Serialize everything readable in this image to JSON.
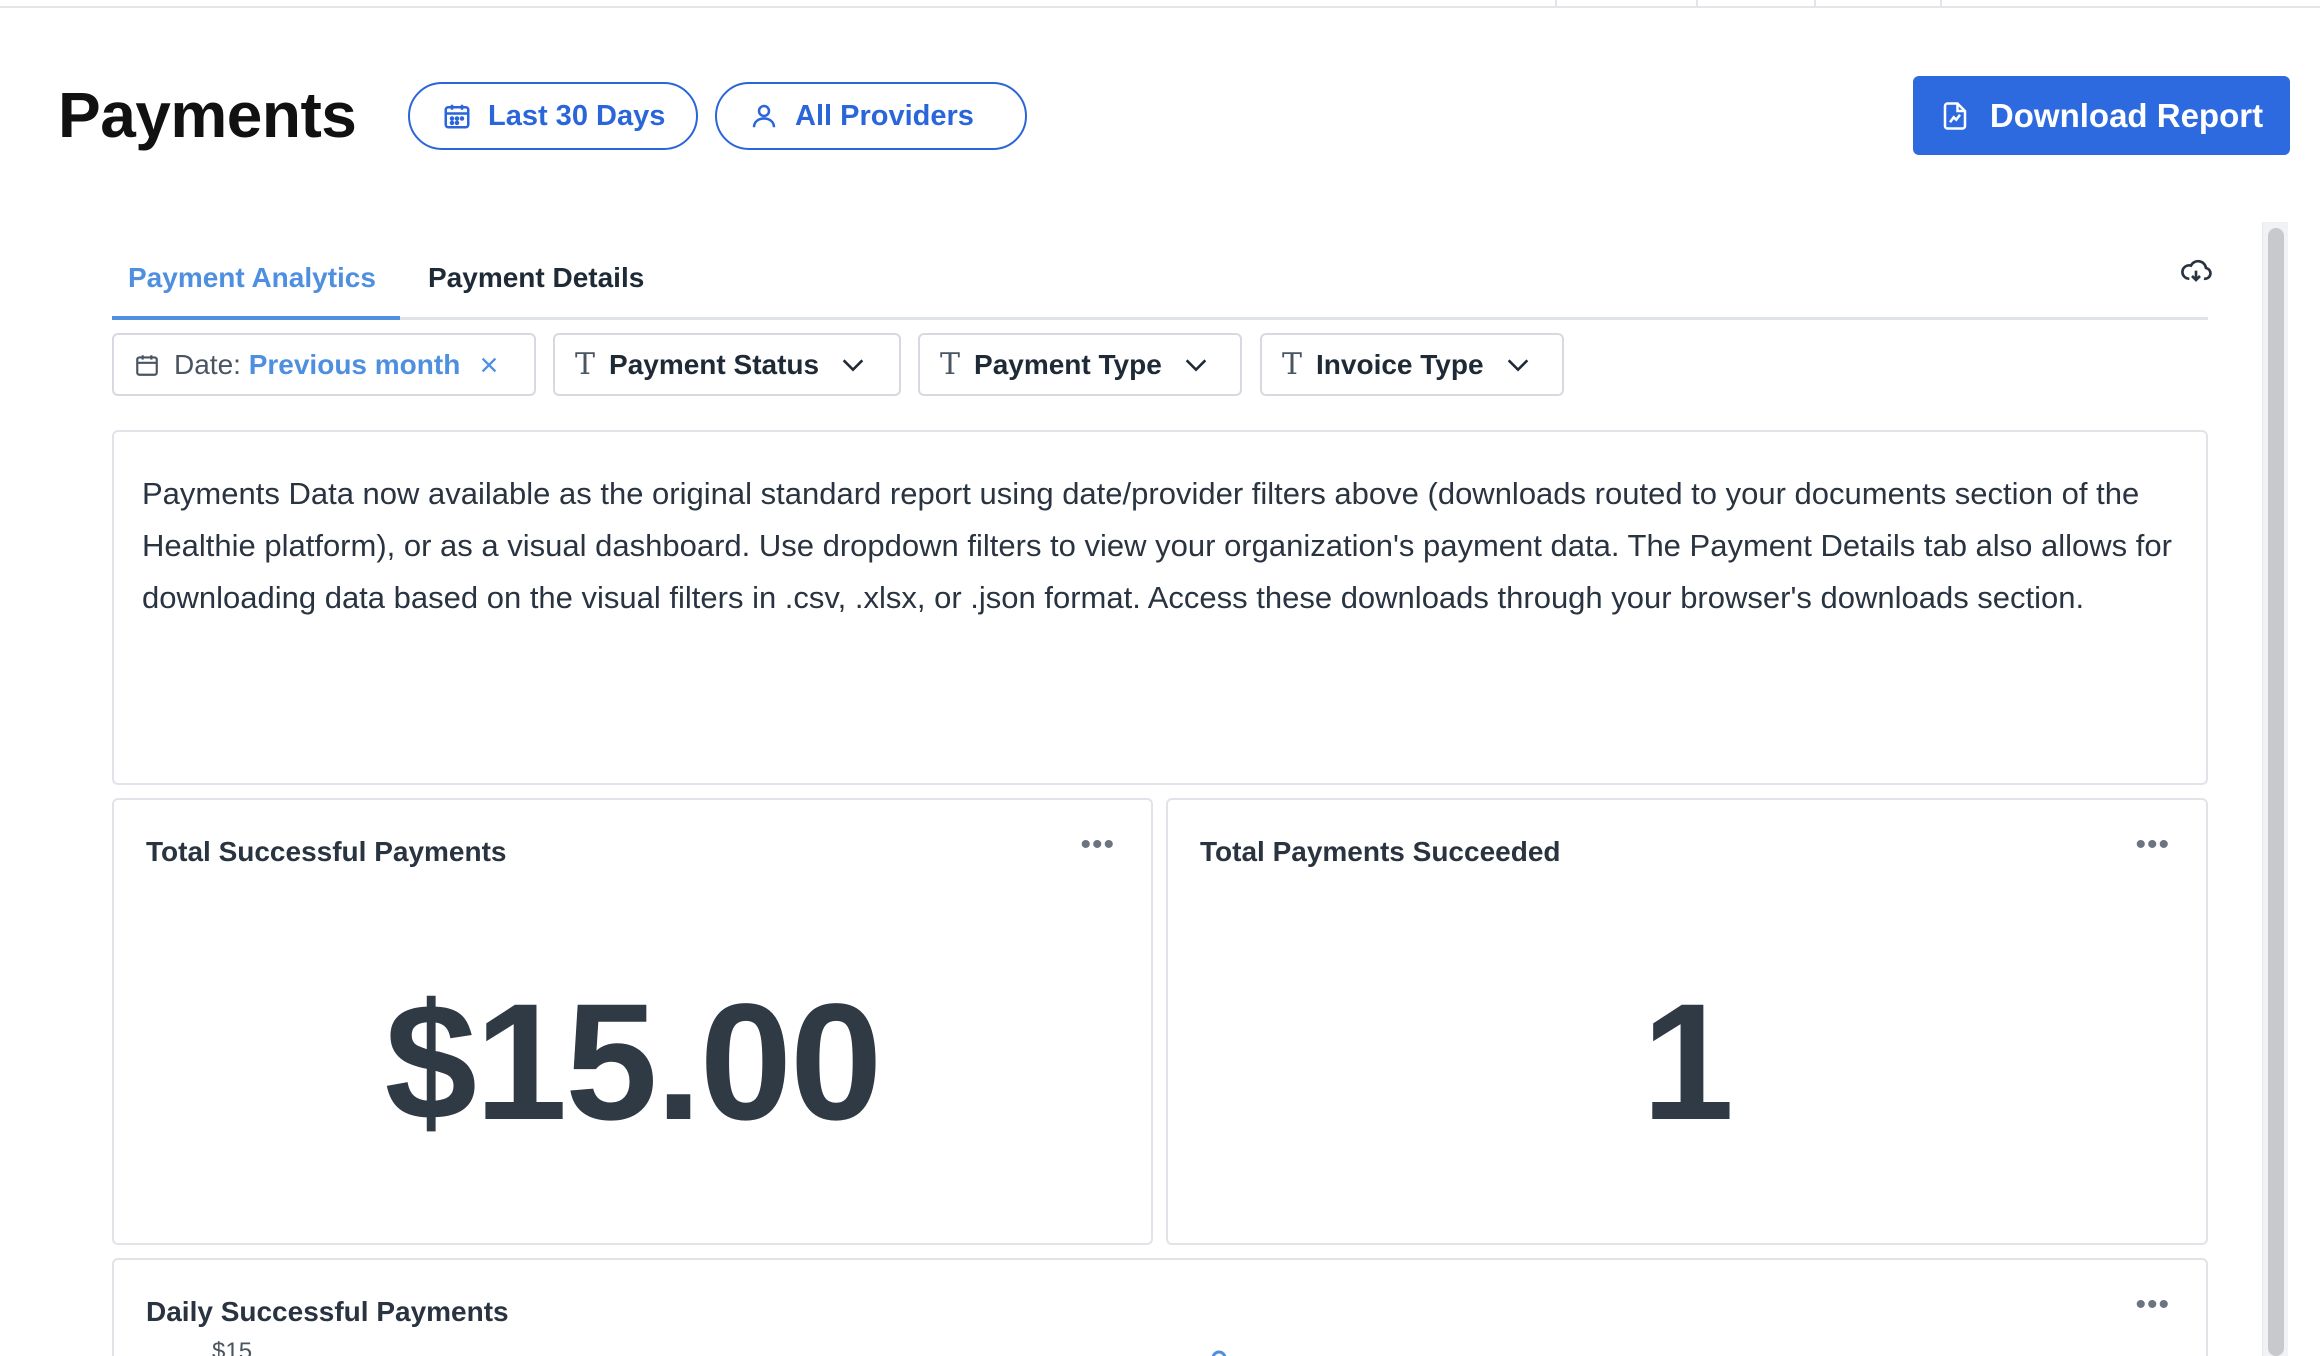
{
  "header": {
    "title": "Payments",
    "date_pill": "Last 30 Days",
    "provider_pill": "All Providers",
    "download_button": "Download Report"
  },
  "tabs": [
    {
      "label": "Payment Analytics",
      "active": true
    },
    {
      "label": "Payment Details",
      "active": false
    }
  ],
  "filters": {
    "date_label": "Date:",
    "date_value": "Previous month",
    "payment_status": "Payment Status",
    "payment_type": "Payment Type",
    "invoice_type": "Invoice Type"
  },
  "info_text": "Payments Data now available as the original standard report using date/provider filters above (downloads routed to your documents section of the Healthie platform), or as a visual dashboard. Use dropdown filters to view your organization's payment data. The Payment Details tab also allows for downloading data based on the visual filters in .csv, .xlsx, or .json format. Access these downloads through your browser's downloads section.",
  "cards": {
    "total_successful_payments": {
      "title": "Total Successful Payments",
      "value": "$15.00"
    },
    "total_payments_succeeded": {
      "title": "Total Payments Succeeded",
      "value": "1"
    },
    "daily_successful_payments": {
      "title": "Daily Successful Payments",
      "y_tick": "$15"
    }
  },
  "chart_data": {
    "type": "line",
    "title": "Daily Successful Payments",
    "y_ticks": [
      "$15"
    ],
    "series": [
      {
        "values": [
          15
        ]
      }
    ]
  },
  "icons": {
    "calendar": "calendar-icon",
    "user": "user-icon",
    "document": "document-chart-icon",
    "cloud": "cloud-download-icon",
    "text_type": "text-type-icon",
    "chevron": "chevron-down-icon",
    "close": "close-icon",
    "more": "more-icon"
  },
  "colors": {
    "accent": "#2d6ae0",
    "tab_active": "#4f8fe0",
    "text_dark": "#2f3a45"
  }
}
